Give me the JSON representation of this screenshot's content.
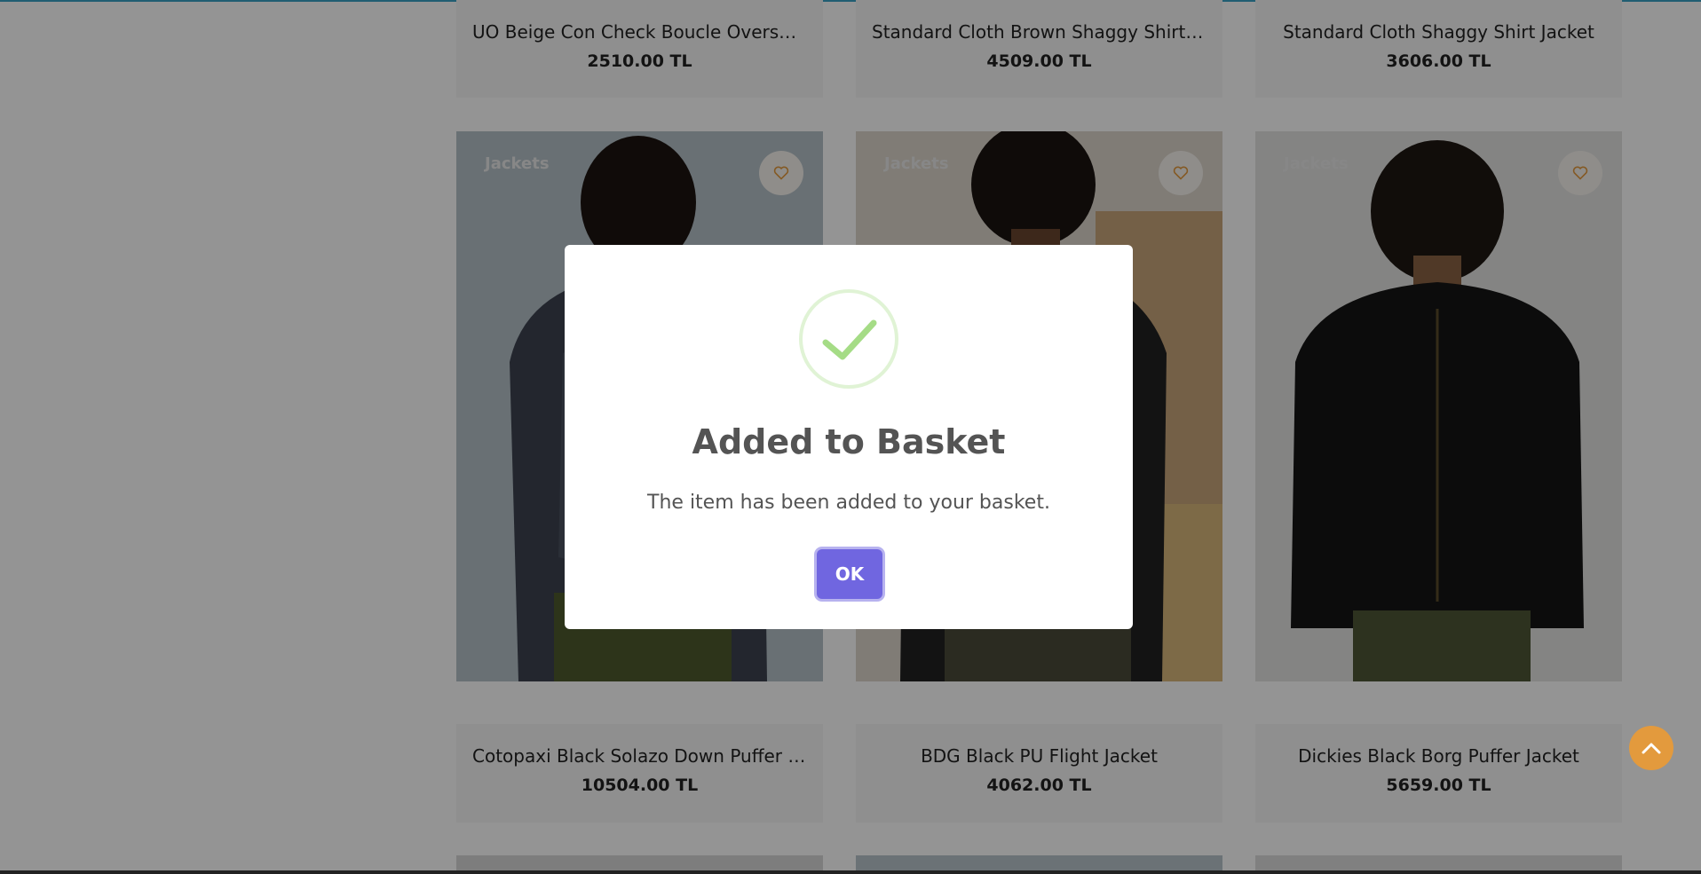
{
  "row1": [
    {
      "name": "UO Beige Con Check Boucle Overshirt",
      "price": "2510.00 TL"
    },
    {
      "name": "Standard Cloth Brown Shaggy Shirt ...",
      "price": "4509.00 TL"
    },
    {
      "name": "Standard Cloth Shaggy Shirt Jacket",
      "price": "3606.00 TL"
    }
  ],
  "row2": [
    {
      "category": "Jackets",
      "name": "Cotopaxi Black Solazo Down Puffer J...",
      "price": "10504.00 TL"
    },
    {
      "category": "Jackets",
      "name": "BDG Black PU Flight Jacket",
      "price": "4062.00 TL"
    },
    {
      "category": "Jackets",
      "name": "Dickies Black Borg Puffer Jacket",
      "price": "5659.00 TL"
    }
  ],
  "icons": {
    "favorite": "heart-icon",
    "scroll_top": "chevron-up-icon",
    "success": "checkmark-icon"
  },
  "dialog": {
    "title": "Added to Basket",
    "message": "The item has been added to your basket.",
    "ok_label": "OK"
  },
  "colors": {
    "accent": "#7066e0",
    "success": "#a5dc86",
    "scroll_button": "#e39a3d",
    "heart": "#e39a3d"
  }
}
